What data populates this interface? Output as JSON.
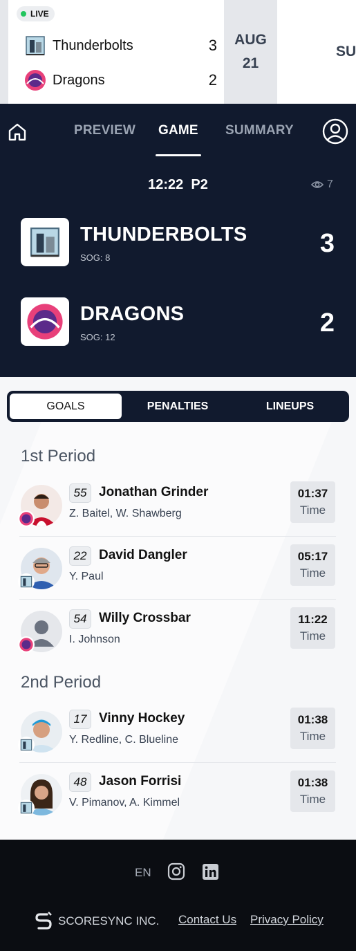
{
  "ticker": {
    "live_label": "LIVE",
    "teams": [
      {
        "name": "Thunderbolts",
        "score": "3",
        "logo_icon": "thunderbolts-logo"
      },
      {
        "name": "Dragons",
        "score": "2",
        "logo_icon": "dragons-logo"
      }
    ],
    "date_month": "AUG",
    "date_day": "21",
    "next_card_partial": "SU"
  },
  "nav": {
    "tabs": [
      {
        "label": "PREVIEW",
        "active": false
      },
      {
        "label": "GAME",
        "active": true
      },
      {
        "label": "SUMMARY",
        "active": false
      }
    ],
    "home_icon": "home-icon",
    "profile_icon": "user-circle-icon"
  },
  "game": {
    "clock": "12:22",
    "period": "P2",
    "viewers": "7",
    "home": {
      "name": "THUNDERBOLTS",
      "sog": "SOG: 8",
      "score": "3"
    },
    "away": {
      "name": "DRAGONS",
      "sog": "SOG: 12",
      "score": "2"
    }
  },
  "segments": [
    {
      "label": "GOALS",
      "active": true
    },
    {
      "label": "PENALTIES",
      "active": false
    },
    {
      "label": "LINEUPS",
      "active": false
    }
  ],
  "periods": [
    {
      "title": "1st Period",
      "goals": [
        {
          "number": "55",
          "player": "Jonathan Grinder",
          "assists": "Z. Baitel, W. Shawberg",
          "time": "01:37",
          "time_label": "Time",
          "team": "dragons"
        },
        {
          "number": "22",
          "player": "David Dangler",
          "assists": "Y. Paul",
          "time": "05:17",
          "time_label": "Time",
          "team": "thunderbolts"
        },
        {
          "number": "54",
          "player": "Willy Crossbar",
          "assists": "I. Johnson",
          "time": "11:22",
          "time_label": "Time",
          "team": "dragons"
        }
      ]
    },
    {
      "title": "2nd Period",
      "goals": [
        {
          "number": "17",
          "player": "Vinny Hockey",
          "assists": "Y. Redline, C. Blueline",
          "time": "01:38",
          "time_label": "Time",
          "team": "thunderbolts"
        },
        {
          "number": "48",
          "player": "Jason Forrisi",
          "assists": "V. Pimanov, A. Kimmel",
          "time": "01:38",
          "time_label": "Time",
          "team": "thunderbolts"
        }
      ]
    }
  ],
  "footer": {
    "language": "EN",
    "brand": "SCORESYNC INC.",
    "contact": "Contact Us",
    "privacy": "Privacy Policy"
  },
  "colors": {
    "header_bg": "#111a2e",
    "footer_bg": "#0b0d12",
    "live_dot": "#22c55e"
  }
}
